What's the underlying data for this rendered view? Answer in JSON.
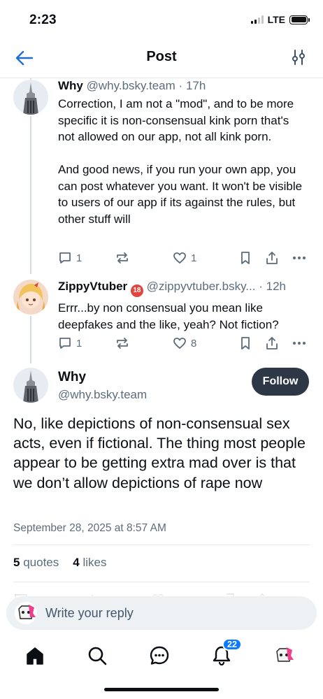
{
  "status_bar": {
    "time": "2:23",
    "network": "LTE"
  },
  "header": {
    "title": "Post",
    "back_icon": "arrow-left-icon",
    "filter_icon": "sliders-icon"
  },
  "thread": [
    {
      "author": "Why",
      "handle": "@why.bsky.team",
      "separator": "·",
      "age": "17h",
      "text": "Correction, I am not a \"mod\", and to be more specific it is non-consensual kink porn that's not allowed on our app, not all kink porn.\n\nAnd good news, if you run your own app, you can post whatever you want. It won't be visible to users of our app if its against the rules, but other stuff will",
      "replies": "1",
      "reposts": "",
      "likes": "1"
    },
    {
      "author": "ZippyVtuber",
      "handle": "@zippyvtuber.bsky...",
      "separator": "·",
      "age": "12h",
      "adult_badge": "18",
      "text": "Errr...by non consensual you mean like deepfakes and the like, yeah? Not fiction?",
      "replies": "1",
      "reposts": "",
      "likes": "8"
    }
  ],
  "focused_post": {
    "author": "Why",
    "handle": "@why.bsky.team",
    "follow_label": "Follow",
    "text": "No, like depictions of non-consensual sex acts, even if fictional. The thing most people appear to be getting extra mad over is that we don’t allow depictions of rape now",
    "date": "September 28, 2025 at 8:57 AM",
    "quotes_count": "5",
    "quotes_label": "quotes",
    "likes_count": "4",
    "likes_label": "likes"
  },
  "composer": {
    "placeholder": "Write your reply"
  },
  "tab_bar": {
    "items": [
      "home-icon",
      "search-icon",
      "chat-icon",
      "bell-icon",
      "profile-avatar"
    ],
    "notifications_badge": "22"
  },
  "colors": {
    "accent": "#0a7aff",
    "muted": "#5d6c7a",
    "follow_bg": "#2d3745"
  }
}
